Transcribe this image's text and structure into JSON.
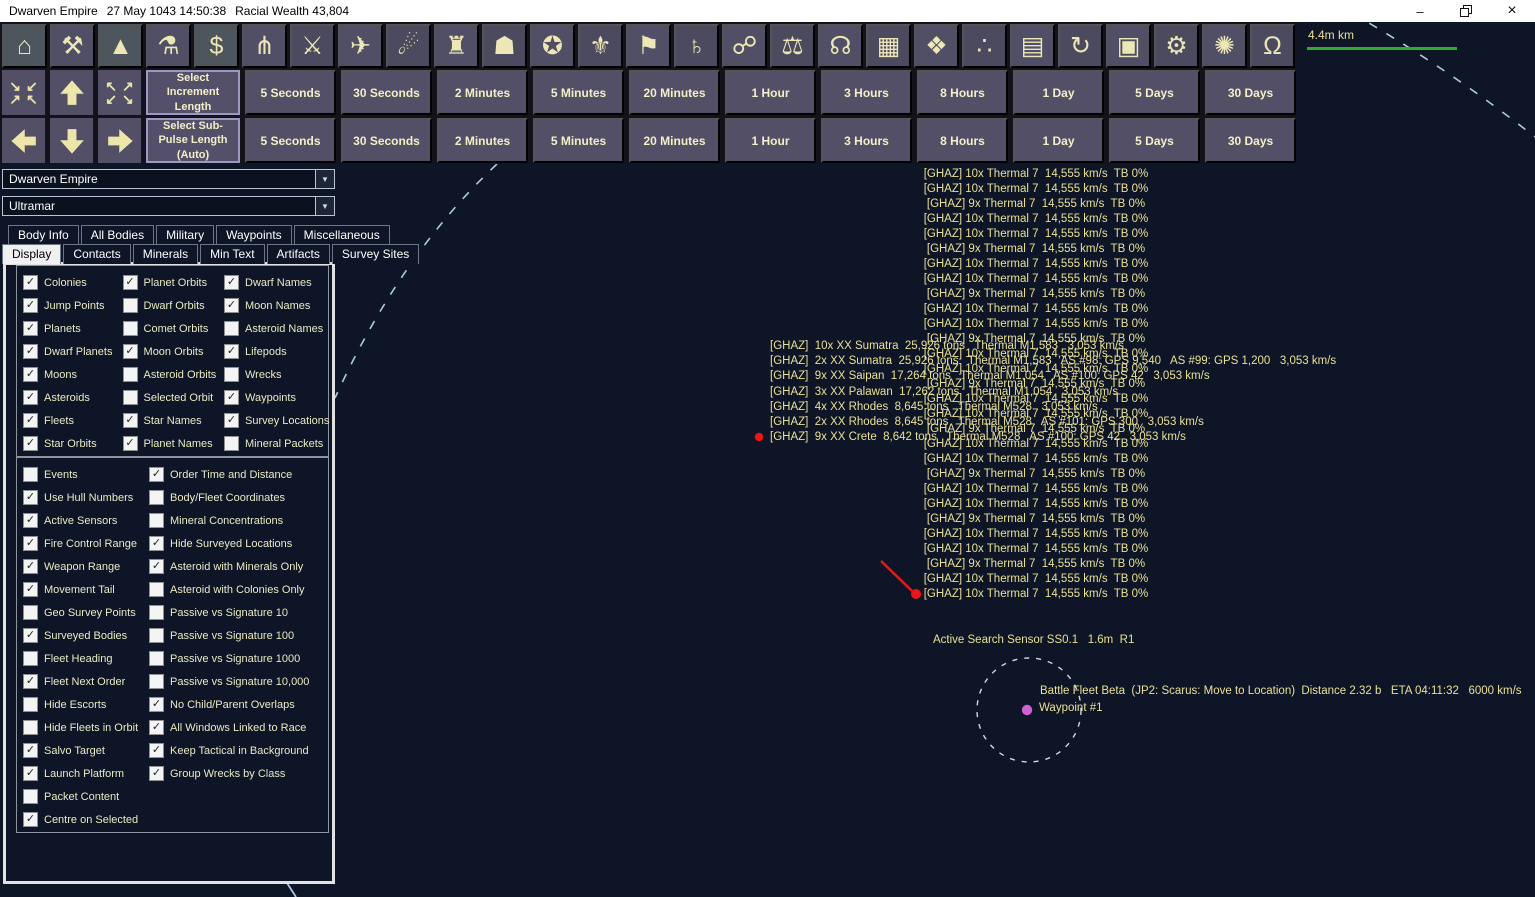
{
  "colors": {
    "map_background": "#0d1526",
    "button_background": "#534f66",
    "button_text": "#f3efc6",
    "map_text_yellow": "#e9e095",
    "scale_green": "#2dab32",
    "orbit_blue": "#a9cbe4",
    "alert_red": "#ee1414",
    "waypoint_magenta": "#d45fd4"
  },
  "title_bar": {
    "app": "Dwarven Empire",
    "datetime": "27 May 1043 14:50:38",
    "wealth": "Racial Wealth 43,804",
    "minimize_glyph": "–",
    "close_glyph": "×"
  },
  "scale": {
    "label": "4.4m km"
  },
  "toolbar": {
    "icons": [
      {
        "name": "economy-icon",
        "glyph": "⌂"
      },
      {
        "name": "industry-icon",
        "glyph": "⚒"
      },
      {
        "name": "mining-icon",
        "glyph": "▲"
      },
      {
        "name": "research-icon",
        "glyph": "⚗"
      },
      {
        "name": "wealth-icon",
        "glyph": "$"
      },
      {
        "name": "logistics-icon",
        "glyph": "⋔"
      },
      {
        "name": "class-design-icon",
        "glyph": "⚔"
      },
      {
        "name": "shipyard-icon",
        "glyph": "✈"
      },
      {
        "name": "missile-design-icon",
        "glyph": "☄"
      },
      {
        "name": "turret-design-icon",
        "glyph": "♜"
      },
      {
        "name": "ground-forces-icon",
        "glyph": "☗"
      },
      {
        "name": "commanders-icon",
        "glyph": "✪"
      },
      {
        "name": "medals-icon",
        "glyph": "⚜"
      },
      {
        "name": "race-flag-icon",
        "glyph": "⚑"
      },
      {
        "name": "system-view-icon",
        "glyph": "♄"
      },
      {
        "name": "galactic-map-icon",
        "glyph": "☍"
      },
      {
        "name": "intelligence-icon",
        "glyph": "⚖"
      },
      {
        "name": "sensor-icon",
        "glyph": "☊"
      },
      {
        "name": "technology-icon",
        "glyph": "▦"
      },
      {
        "name": "minerals-icon",
        "glyph": "❖"
      },
      {
        "name": "asteroids-icon",
        "glyph": "∴"
      },
      {
        "name": "calendar-icon",
        "glyph": "▤"
      },
      {
        "name": "refresh-icon",
        "glyph": "↻"
      },
      {
        "name": "save-icon",
        "glyph": "▣"
      },
      {
        "name": "settings-gear-icon",
        "glyph": "⚙"
      },
      {
        "name": "game-options-icon",
        "glyph": "✺"
      },
      {
        "name": "power-icon",
        "glyph": "Ω"
      }
    ]
  },
  "nav": {
    "contract_top": "↘↙",
    "contract_bottom": "↗↖",
    "expand_top": "↖↗",
    "expand_bottom": "↙↘"
  },
  "increments": {
    "select_increment": "Select Increment Length",
    "select_subpulse": "Select Sub-Pulse Length (Auto)",
    "buttons": [
      "5 Seconds",
      "30 Seconds",
      "2 Minutes",
      "5 Minutes",
      "20 Minutes",
      "1 Hour",
      "3 Hours",
      "8 Hours",
      "1 Day",
      "5 Days",
      "30 Days"
    ]
  },
  "dropdowns": {
    "race": "Dwarven Empire",
    "system": "Ultramar"
  },
  "tabs": {
    "row1": [
      "Body Info",
      "All Bodies",
      "Military",
      "Waypoints",
      "Miscellaneous"
    ],
    "row2": [
      "Display",
      "Contacts",
      "Minerals",
      "Min Text",
      "Artifacts",
      "Survey Sites"
    ],
    "selected": "Display"
  },
  "display_options": {
    "map_features": {
      "col1": [
        [
          "Colonies",
          true
        ],
        [
          "Jump Points",
          true
        ],
        [
          "Planets",
          true
        ],
        [
          "Dwarf Planets",
          true
        ],
        [
          "Moons",
          true
        ],
        [
          "Asteroids",
          true
        ],
        [
          "Fleets",
          true
        ],
        [
          "Star Orbits",
          true
        ]
      ],
      "col2": [
        [
          "Planet Orbits",
          true
        ],
        [
          "Dwarf Orbits",
          false
        ],
        [
          "Comet Orbits",
          false
        ],
        [
          "Moon Orbits",
          true
        ],
        [
          "Asteroid Orbits",
          false
        ],
        [
          "Selected Orbit",
          false
        ],
        [
          "Star Names",
          true
        ],
        [
          "Planet Names",
          true
        ]
      ],
      "col3": [
        [
          "Dwarf Names",
          true
        ],
        [
          "Moon Names",
          true
        ],
        [
          "Asteroid Names",
          false
        ],
        [
          "Lifepods",
          true
        ],
        [
          "Wrecks",
          false
        ],
        [
          "Waypoints",
          true
        ],
        [
          "Survey Locations",
          true
        ],
        [
          "Mineral Packets",
          false
        ]
      ]
    },
    "detail_options": {
      "col1": [
        [
          "Events",
          false
        ],
        [
          "Use Hull Numbers",
          true
        ],
        [
          "Active Sensors",
          true
        ],
        [
          "Fire Control Range",
          true
        ],
        [
          "Weapon Range",
          true
        ],
        [
          "Movement Tail",
          true
        ],
        [
          "Geo Survey Points",
          false
        ],
        [
          "Surveyed Bodies",
          true
        ],
        [
          "Fleet Heading",
          false
        ],
        [
          "Fleet Next Order",
          true
        ],
        [
          "Hide Escorts",
          false
        ],
        [
          "Hide Fleets in Orbit",
          false
        ],
        [
          "Salvo Target",
          true
        ],
        [
          "Launch Platform",
          true
        ],
        [
          "Packet Content",
          false
        ],
        [
          "Centre on Selected",
          true
        ]
      ],
      "col2": [
        [
          "Order Time and Distance",
          true
        ],
        [
          "Body/Fleet Coordinates",
          false
        ],
        [
          "Mineral Concentrations",
          false
        ],
        [
          "Hide Surveyed Locations",
          true
        ],
        [
          "Asteroid with Minerals Only",
          true
        ],
        [
          "Asteroid with Colonies Only",
          false
        ],
        [
          "Passive vs Signature 10",
          false
        ],
        [
          "Passive vs Signature 100",
          false
        ],
        [
          "Passive vs Signature 1000",
          false
        ],
        [
          "Passive vs Signature 10,000",
          false
        ],
        [
          "No Child/Parent Overlaps",
          true
        ],
        [
          "All Windows Linked to Race",
          true
        ],
        [
          "Keep Tactical in Background",
          true
        ],
        [
          "Group Wrecks by Class",
          true
        ]
      ]
    }
  },
  "map": {
    "thermal_contacts": {
      "prefix": "[GHAZ]",
      "name": "Thermal 7",
      "speed": "14,555 km/s",
      "tb": "TB 0%",
      "counts": [
        "10x",
        "10x",
        "9x",
        "10x",
        "10x",
        "9x",
        "10x",
        "10x",
        "9x",
        "10x",
        "10x",
        "9x",
        "10x",
        "10x",
        "9x",
        "10x",
        "10x",
        "9x",
        "10x",
        "10x",
        "9x",
        "10x",
        "10x",
        "9x",
        "10x",
        "10x",
        "9x",
        "10x",
        "10x"
      ]
    },
    "ship_contacts": [
      "[GHAZ]  10x XX Sumatra  25,926 tons   Thermal M1,583   3,053 km/s",
      "[GHAZ]  2x XX Sumatra  25,926 tons   Thermal M1,583   AS #98: GPS 9,540   AS #99: GPS 1,200   3,053 km/s",
      "[GHAZ]  9x XX Saipan  17,264 tons   Thermal M1,054   AS #100: GPS 42   3,053 km/s",
      "[GHAZ]  3x XX Palawan  17,262 tons   Thermal M1,054   3,053 km/s",
      "[GHAZ]  4x XX Rhodes  8,645 tons   Thermal M528   3,053 km/s",
      "[GHAZ]  2x XX Rhodes  8,645 tons   Thermal M528   AS #101: GPS 300   3,053 km/s",
      "[GHAZ]  9x XX Crete  8,642 tons   Thermal M528   AS #100: GPS 42   3,053 km/s"
    ],
    "sensor_label": "Active Search Sensor SS0.1   1.6m  R1",
    "fleet_label": "Battle Fleet Beta  (JP2: Scarus: Move to Location)  Distance 2.32 b   ETA 04:11:32   6000 km/s",
    "waypoint_label": "Waypoint #1"
  }
}
